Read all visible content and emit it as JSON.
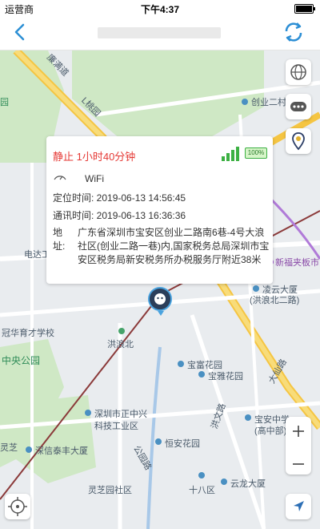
{
  "statusbar": {
    "carrier": "运营商",
    "time": "下午4:37"
  },
  "info": {
    "status": "静止 1小时40分钟",
    "battery": "100%",
    "wifi": "WiFi",
    "location_time": "定位时间: 2019-06-13 14:56:45",
    "comm_time": "通讯时间: 2019-06-13 16:36:36",
    "address_label": "地址:",
    "address": "广东省深圳市宝安区创业二路南6巷-4号大浪社区(创业二路一巷)内,国家税务总局深圳市宝安区税务局新安税务所办税服务厅附近38米"
  },
  "map": {
    "labels": [
      {
        "text": "廉满道",
        "color": "gray"
      },
      {
        "text": "L桃园",
        "color": "gray"
      },
      {
        "text": "创业二村",
        "color": "gray"
      },
      {
        "text": "园",
        "color": "gray"
      },
      {
        "text": "电达工",
        "color": "gray"
      },
      {
        "text": "新福夹板市",
        "color": "purple"
      },
      {
        "text": "凌云大厦",
        "color": "gray"
      },
      {
        "text": "(洪浪北二路)",
        "color": "gray"
      },
      {
        "text": "冠华育才学校",
        "color": "gray"
      },
      {
        "text": "洪浪北",
        "color": "gray"
      },
      {
        "text": "中央公园",
        "color": "green"
      },
      {
        "text": "宝富花园",
        "color": "gray"
      },
      {
        "text": "宝雅花园",
        "color": "gray"
      },
      {
        "text": "深圳市正中兴",
        "color": "gray"
      },
      {
        "text": "科技工业区",
        "color": "gray"
      },
      {
        "text": "宝安中学",
        "color": "gray"
      },
      {
        "text": "(高中部)",
        "color": "gray"
      },
      {
        "text": "深信泰丰大厦",
        "color": "gray"
      },
      {
        "text": "恒安花园",
        "color": "gray"
      },
      {
        "text": "灵芝",
        "color": "gray"
      },
      {
        "text": "灵芝园社区",
        "color": "gray"
      },
      {
        "text": "十八区",
        "color": "gray"
      },
      {
        "text": "云龙大厦",
        "color": "gray"
      },
      {
        "text": "公园路",
        "color": "gray"
      },
      {
        "text": "洪文路",
        "color": "gray"
      },
      {
        "text": "大仙路",
        "color": "gray"
      }
    ]
  },
  "icons": {
    "back": "back-icon",
    "refresh": "refresh-icon",
    "globe": "globe-icon",
    "more": "more-icon",
    "location_pin": "location-pin-icon",
    "zoom_in": "zoom-in-icon",
    "zoom_out": "zoom-out-icon",
    "locate": "locate-icon",
    "navigate": "navigate-icon",
    "wifi": "wifi-icon"
  }
}
